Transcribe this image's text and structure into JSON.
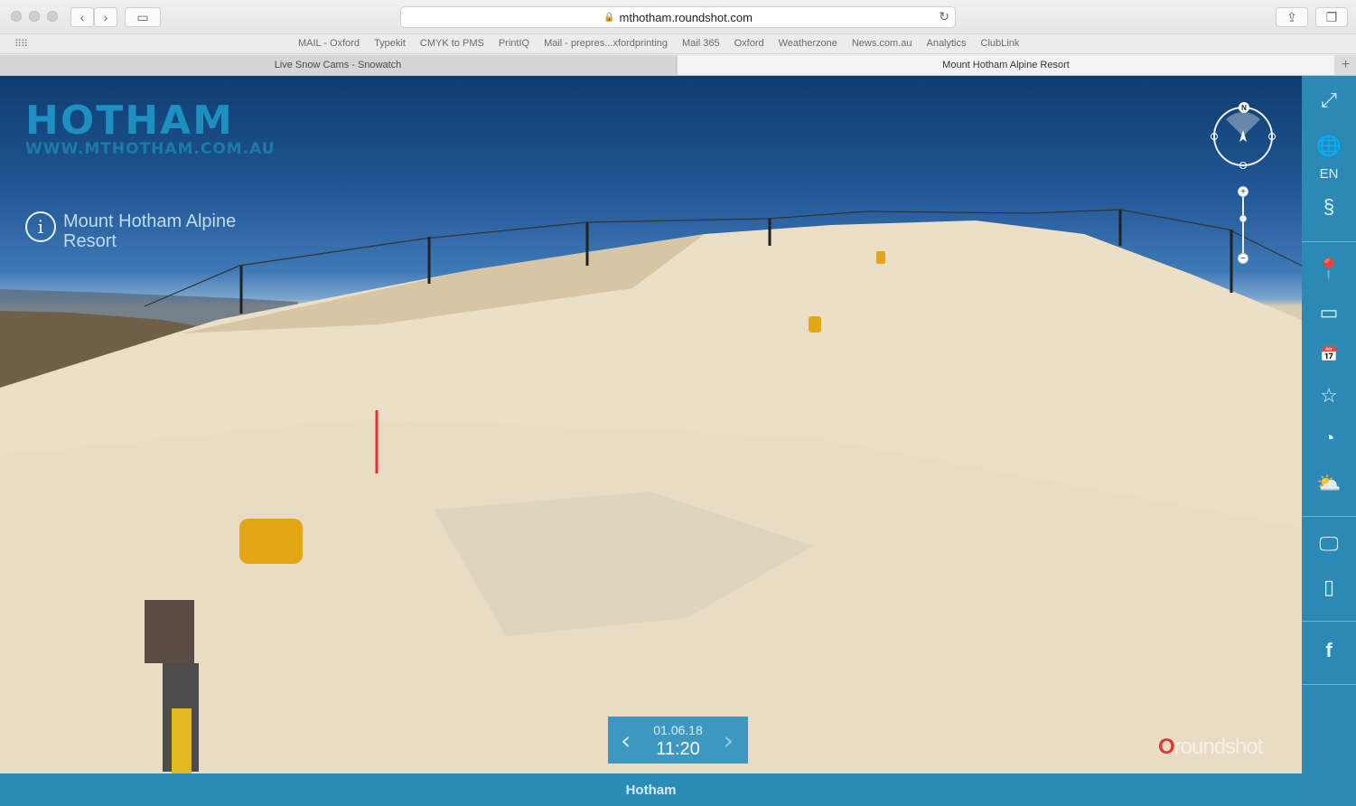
{
  "browser": {
    "url": "mthotham.roundshot.com",
    "bookmarks": [
      "MAIL - Oxford",
      "Typekit",
      "CMYK to PMS",
      "PrintIQ",
      "Mail - prepres...xfordprinting",
      "Mail 365",
      "Oxford",
      "Weatherzone",
      "News.com.au",
      "Analytics",
      "ClubLink"
    ],
    "tabs": [
      {
        "label": "Live Snow Cams - Snowatch",
        "active": false
      },
      {
        "label": "Mount Hotham Alpine Resort",
        "active": true
      }
    ]
  },
  "viewer": {
    "logo_main": "HOTHAM",
    "logo_url": "WWW.MTHOTHAM.COM.AU",
    "location_title": "Mount Hotham Alpine Resort",
    "compass_north": "N",
    "date": "01.06.18",
    "time": "11:20",
    "brand": "roundshot",
    "camera_name": "Hotham"
  },
  "sidepanel": {
    "language": "EN",
    "icons": [
      "fullscreen-icon",
      "globe-icon",
      "paragraph-icon",
      "location-pin-icon",
      "card-icon",
      "calendar-24-icon",
      "star-icon",
      "pie-clock-icon",
      "weather-icon",
      "monitor-icon",
      "phone-info-icon",
      "facebook-icon"
    ]
  },
  "colors": {
    "panel_blue": "#2a8ab5",
    "logo_blue": "#1d8fc0"
  }
}
